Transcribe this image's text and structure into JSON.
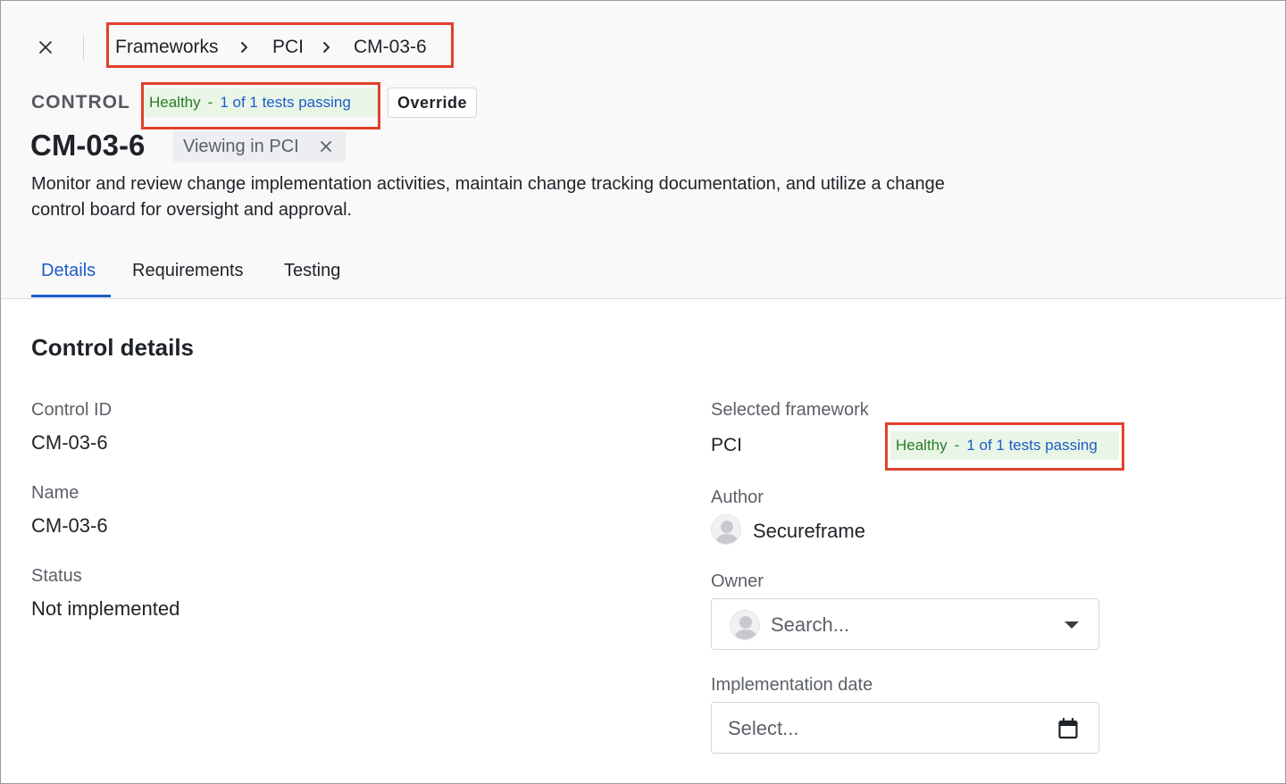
{
  "breadcrumb": {
    "items": [
      "Frameworks",
      "PCI",
      "CM-03-6"
    ]
  },
  "header": {
    "control_label": "CONTROL",
    "health": {
      "status": "Healthy",
      "separator": "-",
      "tests": "1 of 1 tests passing"
    },
    "override_label": "Override",
    "title": "CM-03-6",
    "viewing_chip": "Viewing in PCI",
    "description": "Monitor and review change implementation activities, maintain change tracking documentation, and utilize a change control board for oversight and approval."
  },
  "tabs": [
    {
      "label": "Details",
      "active": true
    },
    {
      "label": "Requirements",
      "active": false
    },
    {
      "label": "Testing",
      "active": false
    }
  ],
  "details": {
    "section_title": "Control details",
    "control_id": {
      "label": "Control ID",
      "value": "CM-03-6"
    },
    "name": {
      "label": "Name",
      "value": "CM-03-6"
    },
    "status": {
      "label": "Status",
      "value": "Not implemented"
    },
    "selected_framework": {
      "label": "Selected framework",
      "value": "PCI",
      "health": {
        "status": "Healthy",
        "separator": "-",
        "tests": "1 of 1 tests passing"
      }
    },
    "author": {
      "label": "Author",
      "value": "Secureframe"
    },
    "owner": {
      "label": "Owner",
      "placeholder": "Search..."
    },
    "implementation_date": {
      "label": "Implementation date",
      "placeholder": "Select..."
    }
  },
  "icons": {
    "close": "close-icon",
    "breadcrumb_separator": "chevron-right-icon",
    "chip_remove": "close-icon",
    "avatar": "user-avatar-icon",
    "dropdown": "caret-down-icon",
    "calendar": "calendar-icon"
  },
  "colors": {
    "accent": "#1d5bc9",
    "healthy_text": "#2c7a28",
    "healthy_bg": "#e9f6e6",
    "highlight_box": "#e0412b"
  }
}
